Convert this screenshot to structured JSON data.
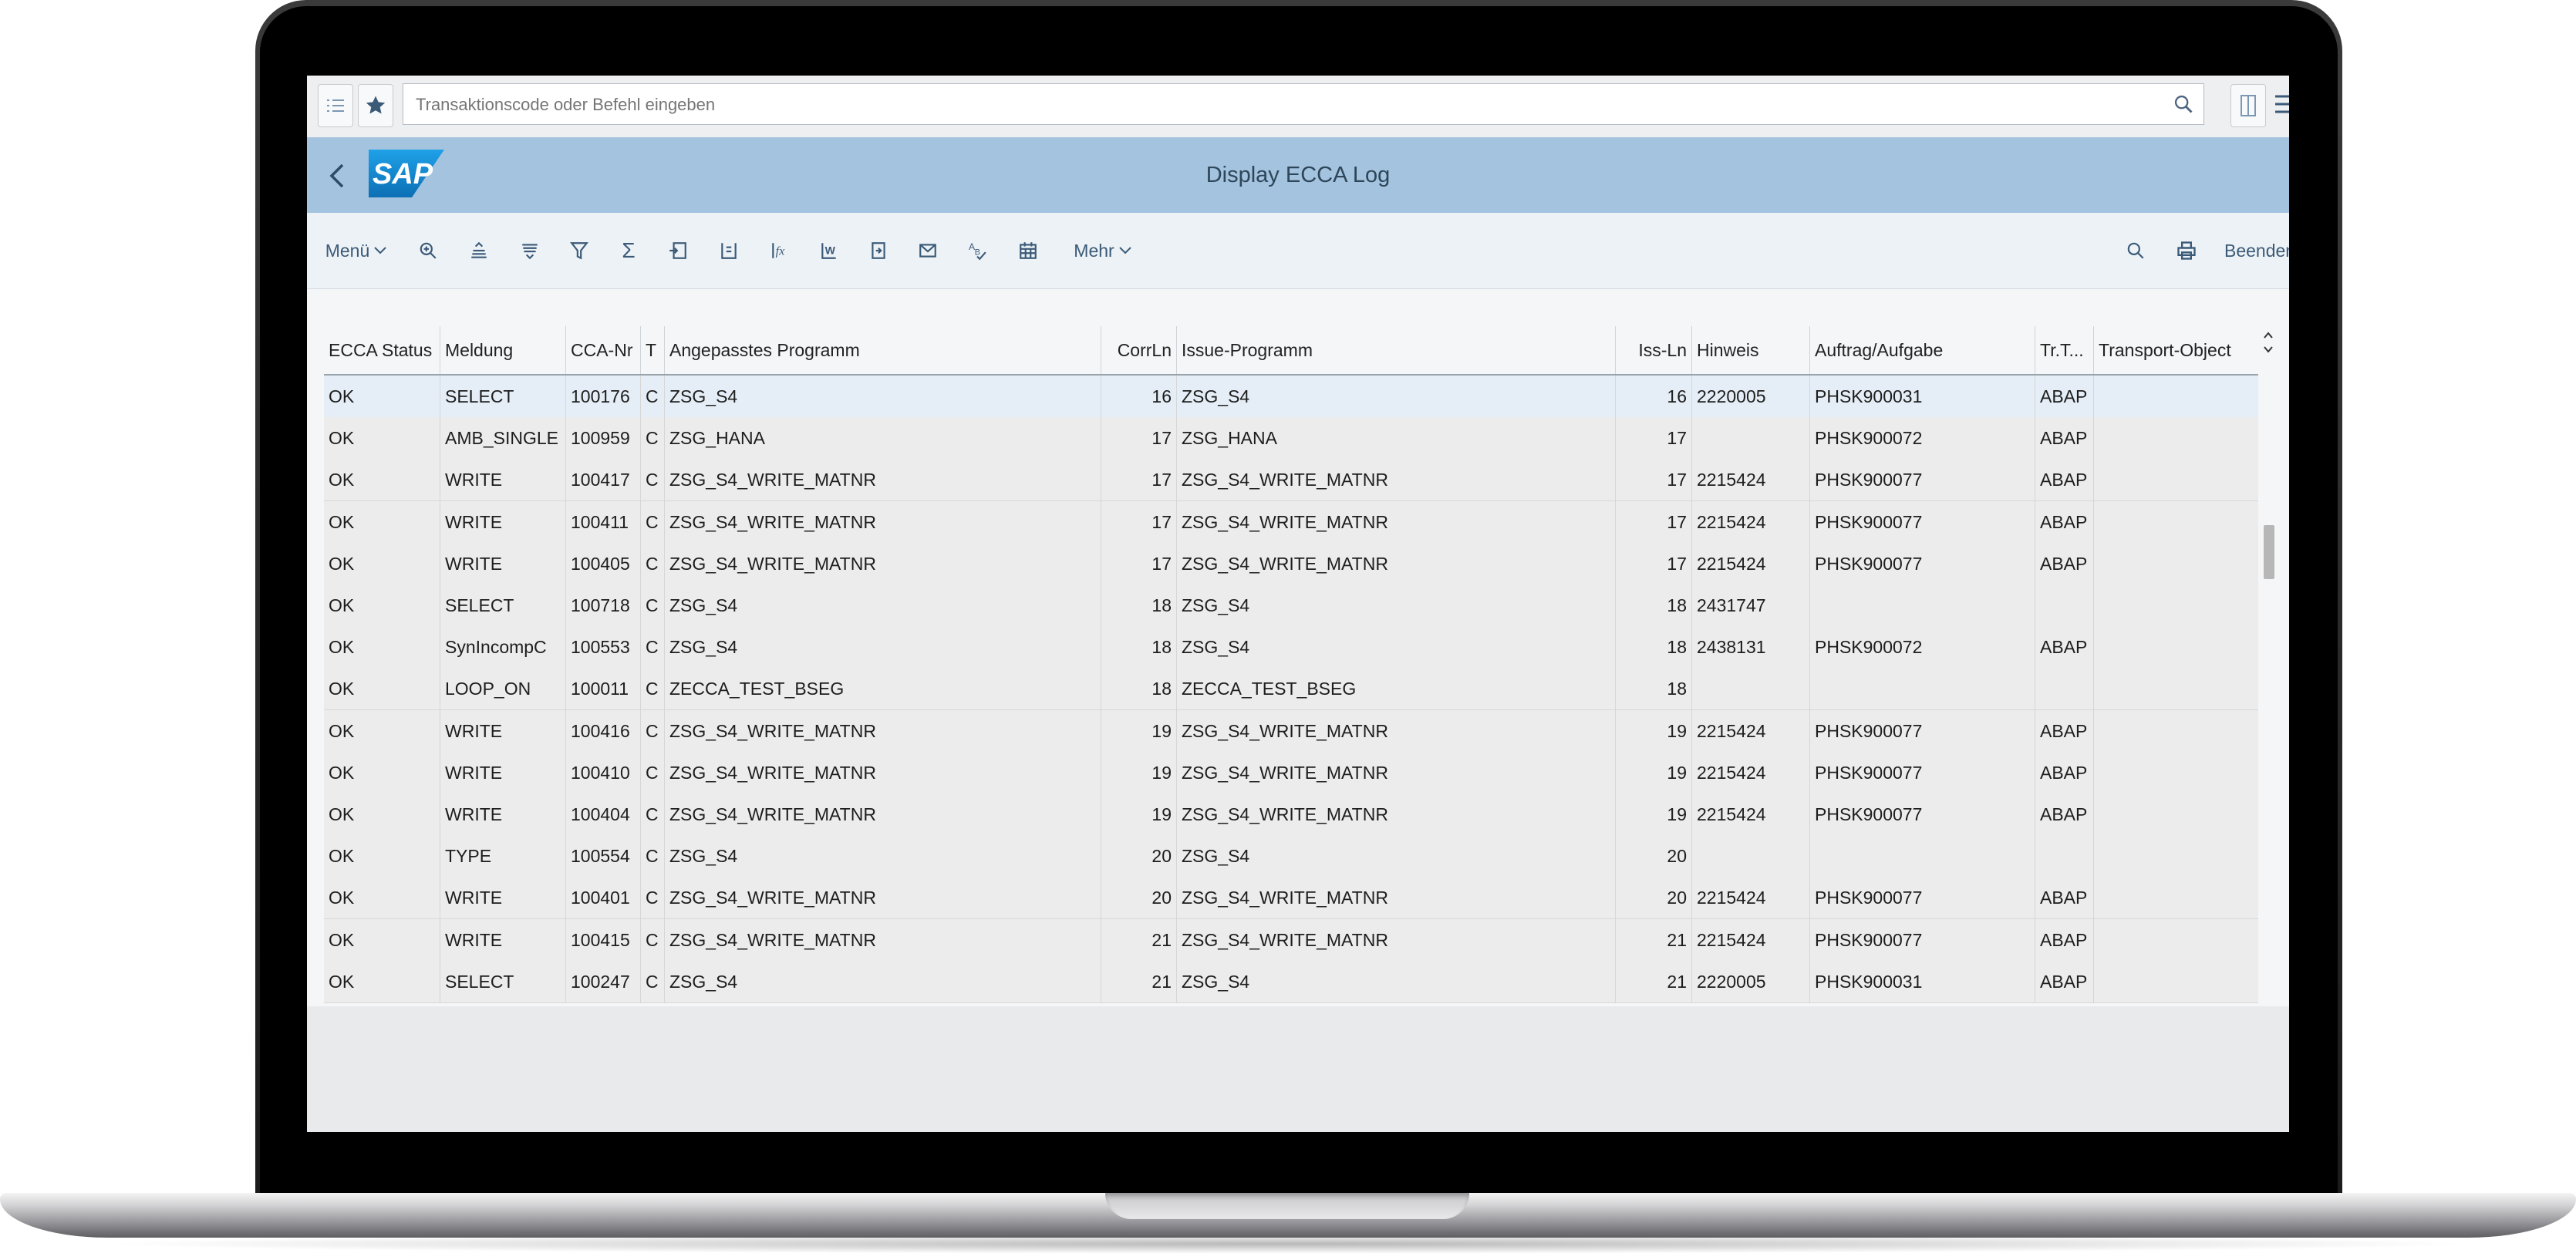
{
  "command_bar": {
    "placeholder": "Transaktionscode oder Befehl eingeben",
    "icons": [
      "list-icon",
      "favorites-star-icon",
      "search-icon",
      "layout-toggle-icon",
      "menu-icon"
    ]
  },
  "header": {
    "logo_text": "SAP",
    "title": "Display ECCA Log"
  },
  "toolbar": {
    "menu_label": "Menü",
    "more_label": "Mehr",
    "exit_label": "Beenden",
    "icons": [
      "details-icon",
      "sort-ascending-icon",
      "sort-descending-icon",
      "filter-icon",
      "sum-icon",
      "export-icon",
      "abc-analysis-icon",
      "calculate-icon",
      "word-processing-icon",
      "local-file-icon",
      "mail-icon",
      "spellcheck-icon",
      "calendar-icon",
      "find-icon",
      "print-icon"
    ]
  },
  "table": {
    "columns": [
      "ECCA Status",
      "Meldung",
      "CCA-Nr",
      "T",
      "Angepasstes Programm",
      "CorrLn",
      "Issue-Programm",
      "Iss-Ln",
      "Hinweis",
      "Auftrag/Aufgabe",
      "Tr.T...",
      "Transport-Object"
    ],
    "rows": [
      [
        "OK",
        "SELECT",
        "100176",
        "C",
        "ZSG_S4",
        "16",
        "ZSG_S4",
        "16",
        "2220005",
        "PHSK900031",
        "ABAP",
        ""
      ],
      [
        "OK",
        "AMB_SINGLE",
        "100959",
        "C",
        "ZSG_HANA",
        "17",
        "ZSG_HANA",
        "17",
        "",
        "PHSK900072",
        "ABAP",
        ""
      ],
      [
        "OK",
        "WRITE",
        "100417",
        "C",
        "ZSG_S4_WRITE_MATNR",
        "17",
        "ZSG_S4_WRITE_MATNR",
        "17",
        "2215424",
        "PHSK900077",
        "ABAP",
        ""
      ],
      [
        "OK",
        "WRITE",
        "100411",
        "C",
        "ZSG_S4_WRITE_MATNR",
        "17",
        "ZSG_S4_WRITE_MATNR",
        "17",
        "2215424",
        "PHSK900077",
        "ABAP",
        ""
      ],
      [
        "OK",
        "WRITE",
        "100405",
        "C",
        "ZSG_S4_WRITE_MATNR",
        "17",
        "ZSG_S4_WRITE_MATNR",
        "17",
        "2215424",
        "PHSK900077",
        "ABAP",
        ""
      ],
      [
        "OK",
        "SELECT",
        "100718",
        "C",
        "ZSG_S4",
        "18",
        "ZSG_S4",
        "18",
        "2431747",
        "",
        "",
        ""
      ],
      [
        "OK",
        "SynIncompC",
        "100553",
        "C",
        "ZSG_S4",
        "18",
        "ZSG_S4",
        "18",
        "2438131",
        "PHSK900072",
        "ABAP",
        ""
      ],
      [
        "OK",
        "LOOP_ON",
        "100011",
        "C",
        "ZECCA_TEST_BSEG",
        "18",
        "ZECCA_TEST_BSEG",
        "18",
        "",
        "",
        "",
        ""
      ],
      [
        "OK",
        "WRITE",
        "100416",
        "C",
        "ZSG_S4_WRITE_MATNR",
        "19",
        "ZSG_S4_WRITE_MATNR",
        "19",
        "2215424",
        "PHSK900077",
        "ABAP",
        ""
      ],
      [
        "OK",
        "WRITE",
        "100410",
        "C",
        "ZSG_S4_WRITE_MATNR",
        "19",
        "ZSG_S4_WRITE_MATNR",
        "19",
        "2215424",
        "PHSK900077",
        "ABAP",
        ""
      ],
      [
        "OK",
        "WRITE",
        "100404",
        "C",
        "ZSG_S4_WRITE_MATNR",
        "19",
        "ZSG_S4_WRITE_MATNR",
        "19",
        "2215424",
        "PHSK900077",
        "ABAP",
        ""
      ],
      [
        "OK",
        "TYPE",
        "100554",
        "C",
        "ZSG_S4",
        "20",
        "ZSG_S4",
        "20",
        "",
        "",
        "",
        ""
      ],
      [
        "OK",
        "WRITE",
        "100401",
        "C",
        "ZSG_S4_WRITE_MATNR",
        "20",
        "ZSG_S4_WRITE_MATNR",
        "20",
        "2215424",
        "PHSK900077",
        "ABAP",
        ""
      ],
      [
        "OK",
        "WRITE",
        "100415",
        "C",
        "ZSG_S4_WRITE_MATNR",
        "21",
        "ZSG_S4_WRITE_MATNR",
        "21",
        "2215424",
        "PHSK900077",
        "ABAP",
        ""
      ],
      [
        "OK",
        "SELECT",
        "100247",
        "C",
        "ZSG_S4",
        "21",
        "ZSG_S4",
        "21",
        "2220005",
        "PHSK900031",
        "ABAP",
        ""
      ]
    ],
    "selected_row": 0
  },
  "colors": {
    "shell_header": "#a4c3df",
    "toolbar": "#edf2f6",
    "row_background": "#ececec",
    "selected_row": "#e5eef6",
    "sap_logo_blue": "#1a8fd6"
  }
}
